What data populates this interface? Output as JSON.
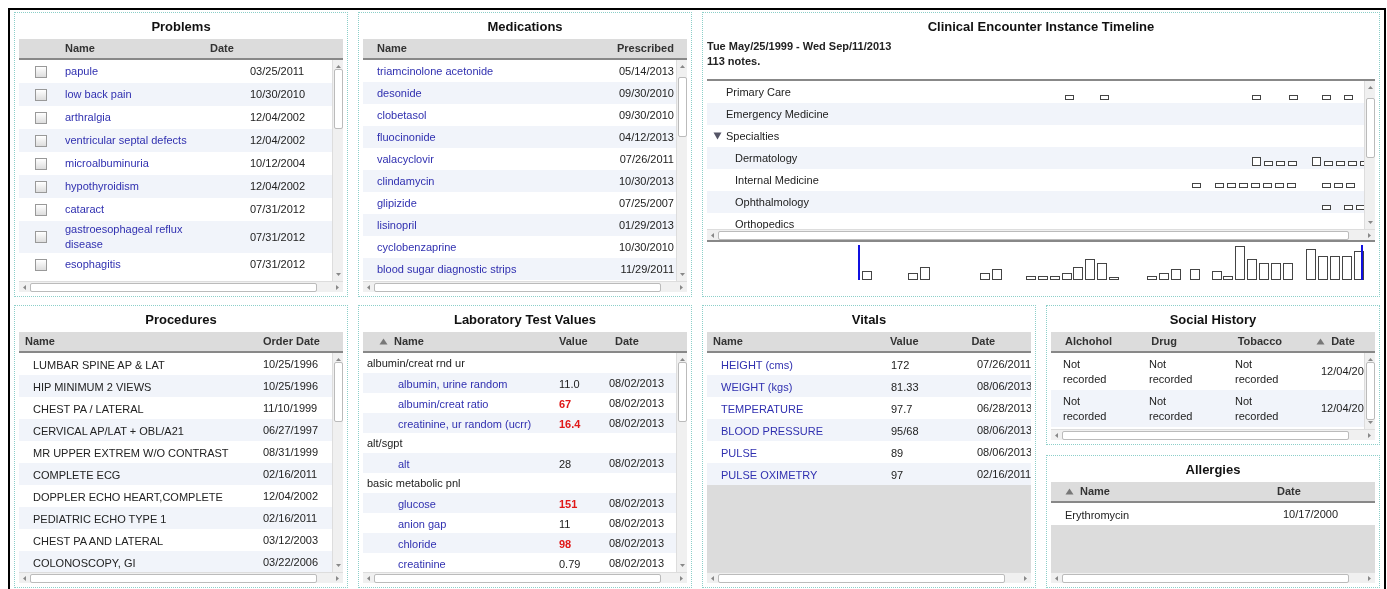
{
  "problems": {
    "title": "Problems",
    "columns": [
      {
        "label": "Name",
        "sorted": false
      },
      {
        "label": "Date",
        "sorted": false
      }
    ],
    "rows": [
      {
        "name": "papule",
        "date": "03/25/2011",
        "checked": false
      },
      {
        "name": "low back pain",
        "date": "10/30/2010",
        "checked": false
      },
      {
        "name": "arthralgia",
        "date": "12/04/2002",
        "checked": false
      },
      {
        "name": "ventricular septal defects",
        "date": "12/04/2002",
        "checked": false
      },
      {
        "name": "microalbuminuria",
        "date": "10/12/2004",
        "checked": false
      },
      {
        "name": "hypothyroidism",
        "date": "12/04/2002",
        "checked": false
      },
      {
        "name": "cataract",
        "date": "07/31/2012",
        "checked": false
      },
      {
        "name": "gastroesophageal reflux disease",
        "date": "07/31/2012",
        "checked": false
      },
      {
        "name": "esophagitis",
        "date": "07/31/2012",
        "checked": false
      }
    ]
  },
  "medications": {
    "title": "Medications",
    "columns": [
      {
        "label": "Name",
        "sorted": false
      },
      {
        "label": "Prescribed",
        "sorted": false
      }
    ],
    "rows": [
      {
        "name": "triamcinolone acetonide",
        "prescribed": "05/14/2013"
      },
      {
        "name": "desonide",
        "prescribed": "09/30/2010"
      },
      {
        "name": "clobetasol",
        "prescribed": "09/30/2010"
      },
      {
        "name": "fluocinonide",
        "prescribed": "04/12/2013"
      },
      {
        "name": "valacyclovir",
        "prescribed": "07/26/2011"
      },
      {
        "name": "clindamycin",
        "prescribed": "10/30/2013"
      },
      {
        "name": "glipizide",
        "prescribed": "07/25/2007"
      },
      {
        "name": "lisinopril",
        "prescribed": "01/29/2013"
      },
      {
        "name": "cyclobenzaprine",
        "prescribed": "10/30/2010"
      },
      {
        "name": "blood sugar diagnostic strips",
        "prescribed": "11/29/2011"
      }
    ]
  },
  "timeline": {
    "title": "Clinical Encounter Instance Timeline",
    "range": "Tue May/25/1999 - Wed Sep/11/2013",
    "count": "113 notes.",
    "rows": [
      {
        "label": "Primary Care"
      },
      {
        "label": "Emergency Medicine"
      },
      {
        "label": "Specialties",
        "expanded": true,
        "children": [
          {
            "label": "Dermatology"
          },
          {
            "label": "Internal Medicine"
          },
          {
            "label": "Ophthalmology"
          },
          {
            "label": "Orthopedics"
          }
        ]
      }
    ]
  },
  "procedures": {
    "title": "Procedures",
    "columns": [
      {
        "label": "Name",
        "sorted": false
      },
      {
        "label": "Order Date",
        "sorted": false
      }
    ],
    "rows": [
      {
        "name": "LUMBAR SPINE AP & LAT",
        "date": "10/25/1996"
      },
      {
        "name": "HIP MINIMUM 2 VIEWS",
        "date": "10/25/1996"
      },
      {
        "name": "CHEST PA / LATERAL",
        "date": "11/10/1999"
      },
      {
        "name": "CERVICAL AP/LAT + OBL/A21",
        "date": "06/27/1997"
      },
      {
        "name": "MR UPPER EXTREM W/O CONTRAST",
        "date": "08/31/1999"
      },
      {
        "name": "COMPLETE ECG",
        "date": "02/16/2011"
      },
      {
        "name": "DOPPLER ECHO HEART,COMPLETE",
        "date": "12/04/2002"
      },
      {
        "name": "PEDIATRIC ECHO TYPE 1",
        "date": "02/16/2011"
      },
      {
        "name": "CHEST PA AND LATERAL",
        "date": "03/12/2003"
      },
      {
        "name": "COLONOSCOPY, GI",
        "date": "03/22/2006"
      }
    ]
  },
  "lab_tests": {
    "title": "Laboratory Test Values",
    "columns": [
      {
        "label": "Name",
        "sorted": true
      },
      {
        "label": "Value",
        "sorted": false
      },
      {
        "label": "Date",
        "sorted": false
      }
    ],
    "rows": [
      {
        "kind": "group",
        "name": "albumin/creat rnd ur"
      },
      {
        "kind": "result",
        "name": "albumin, urine random",
        "value": "11.0",
        "date": "08/02/2013",
        "abnormal": false
      },
      {
        "kind": "result",
        "name": "albumin/creat ratio",
        "value": "67",
        "date": "08/02/2013",
        "abnormal": true
      },
      {
        "kind": "result",
        "name": "creatinine, ur random (ucrr)",
        "value": "16.4",
        "date": "08/02/2013",
        "abnormal": true
      },
      {
        "kind": "group",
        "name": "alt/sgpt"
      },
      {
        "kind": "result",
        "name": "alt",
        "value": "28",
        "date": "08/02/2013",
        "abnormal": false
      },
      {
        "kind": "group",
        "name": "basic metabolic pnl"
      },
      {
        "kind": "result",
        "name": "glucose",
        "value": "151",
        "date": "08/02/2013",
        "abnormal": true
      },
      {
        "kind": "result",
        "name": "anion gap",
        "value": "11",
        "date": "08/02/2013",
        "abnormal": false
      },
      {
        "kind": "result",
        "name": "chloride",
        "value": "98",
        "date": "08/02/2013",
        "abnormal": true
      },
      {
        "kind": "result",
        "name": "creatinine",
        "value": "0.79",
        "date": "08/02/2013",
        "abnormal": false
      }
    ]
  },
  "vitals": {
    "title": "Vitals",
    "columns": [
      {
        "label": "Name",
        "sorted": false
      },
      {
        "label": "Value",
        "sorted": false
      },
      {
        "label": "Date",
        "sorted": false
      }
    ],
    "rows": [
      {
        "name": "HEIGHT (cms)",
        "value": "172",
        "date": "07/26/2011"
      },
      {
        "name": "WEIGHT (kgs)",
        "value": "81.33",
        "date": "08/06/2013"
      },
      {
        "name": "TEMPERATURE",
        "value": "97.7",
        "date": "06/28/2013"
      },
      {
        "name": "BLOOD PRESSURE",
        "value": "95/68",
        "date": "08/06/2013"
      },
      {
        "name": "PULSE",
        "value": "89",
        "date": "08/06/2013"
      },
      {
        "name": "PULSE OXIMETRY",
        "value": "97",
        "date": "02/16/2011"
      }
    ]
  },
  "social_history": {
    "title": "Social History",
    "columns": [
      {
        "label": "Alchohol",
        "sorted": false
      },
      {
        "label": "Drug",
        "sorted": false
      },
      {
        "label": "Tobacco",
        "sorted": false
      },
      {
        "label": "Date",
        "sorted": true
      }
    ],
    "rows": [
      {
        "alcohol": "Not recorded",
        "drug": "Not recorded",
        "tobacco": "Not recorded",
        "date": "12/04/20"
      },
      {
        "alcohol": "Not recorded",
        "drug": "Not recorded",
        "tobacco": "Not recorded",
        "date": "12/04/20"
      }
    ]
  },
  "allergies": {
    "title": "Allergies",
    "columns": [
      {
        "label": "Name",
        "sorted": true
      },
      {
        "label": "Date",
        "sorted": false
      }
    ],
    "rows": [
      {
        "name": "Erythromycin",
        "date": "10/17/2000"
      }
    ]
  }
}
